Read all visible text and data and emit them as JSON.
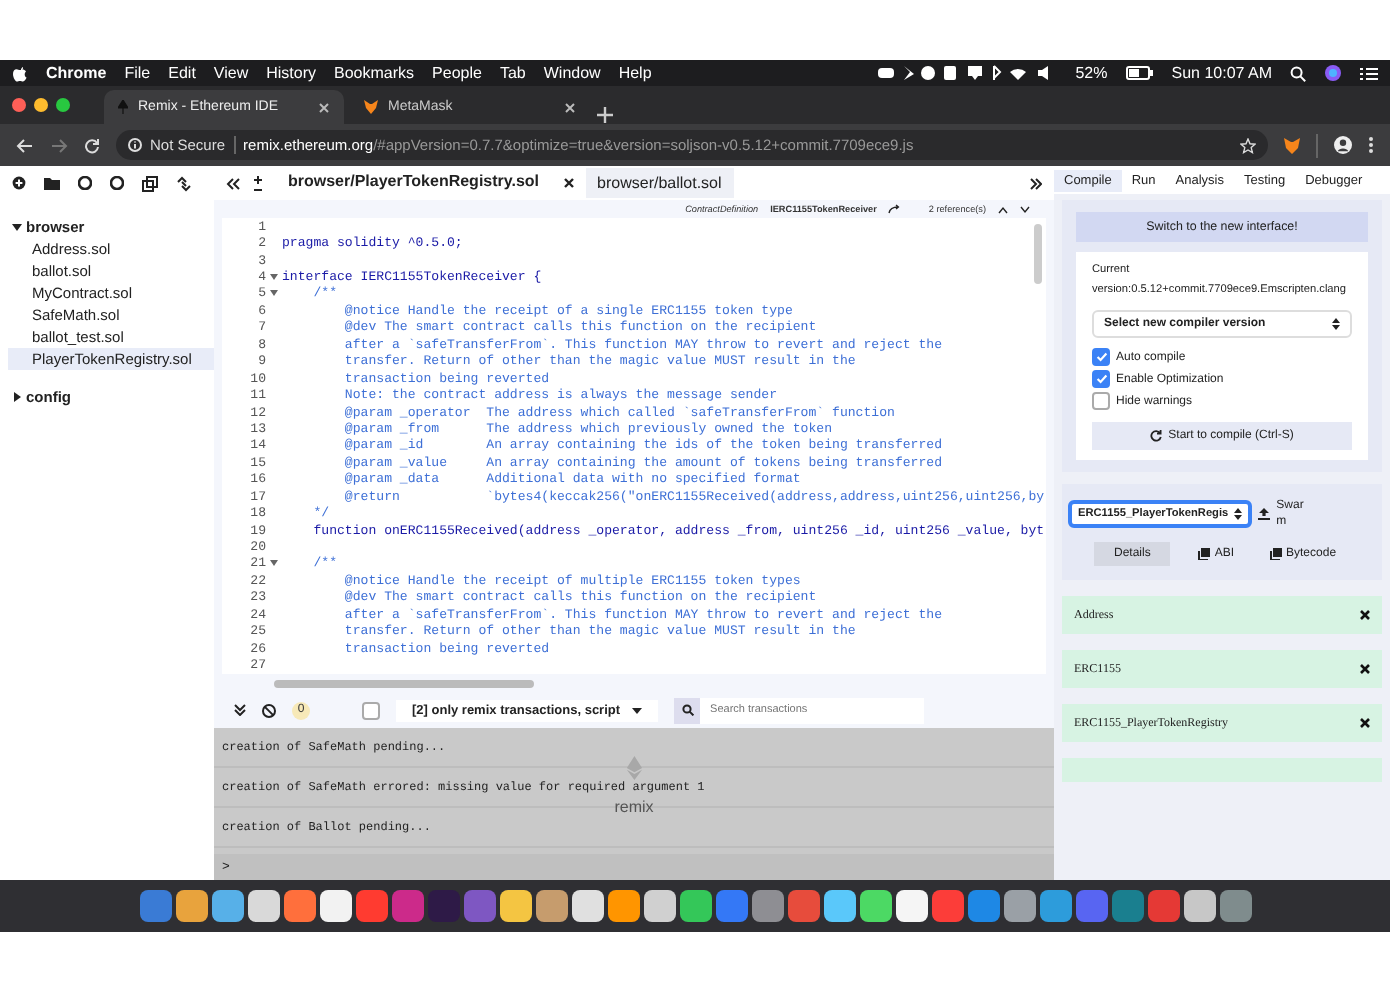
{
  "menu_bar": {
    "app": "Chrome",
    "items": [
      "File",
      "Edit",
      "View",
      "History",
      "Bookmarks",
      "People",
      "Tab",
      "Window",
      "Help"
    ],
    "battery": "52%",
    "clock": "Sun 10:07 AM"
  },
  "browser_tabs": [
    {
      "title": "Remix - Ethereum IDE",
      "selected": true
    },
    {
      "title": "MetaMask",
      "selected": false
    }
  ],
  "address_bar": {
    "security": "Not Secure",
    "host": "remix.ethereum.org",
    "path": "/#appVersion=0.7.7&optimize=true&version=soljson-v0.5.12+commit.7709ece9.js"
  },
  "file_tree": [
    {
      "name": "browser",
      "expanded": true,
      "children": [
        {
          "name": "Address.sol",
          "selected": false
        },
        {
          "name": "ballot.sol",
          "selected": false
        },
        {
          "name": "MyContract.sol",
          "selected": false
        },
        {
          "name": "SafeMath.sol",
          "selected": false
        },
        {
          "name": "ballot_test.sol",
          "selected": false
        },
        {
          "name": "PlayerTokenRegistry.sol",
          "selected": true
        }
      ]
    },
    {
      "name": "config",
      "expanded": false
    }
  ],
  "editor_tabs": [
    {
      "title": "browser/PlayerTokenRegistry.sol",
      "selected": true
    },
    {
      "title": "browser/ballot.sol",
      "selected": false
    }
  ],
  "context": {
    "kind": "ContractDefinition",
    "name": "IERC1155TokenReceiver",
    "references": "2 reference(s)"
  },
  "code_lines": [
    {
      "num": "1",
      "fold": false
    },
    {
      "num": "2",
      "text": "pragma solidity ^0.5.0;",
      "kind": "code",
      "fold": false
    },
    {
      "num": "3",
      "fold": false
    },
    {
      "num": "4",
      "text": "interface IERC1155TokenReceiver {",
      "kind": "code",
      "fold": true
    },
    {
      "num": "5",
      "text": "    /**",
      "kind": "comment",
      "fold": true
    },
    {
      "num": "6",
      "text": "        @notice Handle the receipt of a single ERC1155 token type",
      "kind": "comment",
      "fold": false
    },
    {
      "num": "7",
      "text": "        @dev The smart contract calls this function on the recipient",
      "kind": "comment",
      "fold": false
    },
    {
      "num": "8",
      "text": "        after a `safeTransferFrom`. This function MAY throw to revert and reject the",
      "kind": "comment",
      "fold": false
    },
    {
      "num": "9",
      "text": "        transfer. Return of other than the magic value MUST result in the",
      "kind": "comment",
      "fold": false
    },
    {
      "num": "10",
      "text": "        transaction being reverted",
      "kind": "comment",
      "fold": false
    },
    {
      "num": "11",
      "text": "        Note: the contract address is always the message sender",
      "kind": "comment",
      "fold": false
    },
    {
      "num": "12",
      "text": "        @param _operator  The address which called `safeTransferFrom` function",
      "kind": "comment",
      "fold": false
    },
    {
      "num": "13",
      "text": "        @param _from      The address which previously owned the token",
      "kind": "comment",
      "fold": false
    },
    {
      "num": "14",
      "text": "        @param _id        An array containing the ids of the token being transferred",
      "kind": "comment",
      "fold": false
    },
    {
      "num": "15",
      "text": "        @param _value     An array containing the amount of tokens being transferred",
      "kind": "comment",
      "fold": false
    },
    {
      "num": "16",
      "text": "        @param _data      Additional data with no specified format",
      "kind": "comment",
      "fold": false
    },
    {
      "num": "17",
      "text": "        @return           `bytes4(keccak256(\"onERC1155Received(address,address,uint256,uint256,by",
      "kind": "comment",
      "fold": false
    },
    {
      "num": "18",
      "text": "    */",
      "kind": "comment",
      "fold": false
    },
    {
      "num": "19",
      "text": "    function onERC1155Received(address _operator, address _from, uint256 _id, uint256 _value, byt",
      "kind": "code",
      "fold": false
    },
    {
      "num": "20",
      "fold": false
    },
    {
      "num": "21",
      "text": "    /**",
      "kind": "comment",
      "fold": true
    },
    {
      "num": "22",
      "text": "        @notice Handle the receipt of multiple ERC1155 token types",
      "kind": "comment",
      "fold": false
    },
    {
      "num": "23",
      "text": "        @dev The smart contract calls this function on the recipient",
      "kind": "comment",
      "fold": false
    },
    {
      "num": "24",
      "text": "        after a `safeTransferFrom`. This function MAY throw to revert and reject the",
      "kind": "comment",
      "fold": false
    },
    {
      "num": "25",
      "text": "        transfer. Return of other than the magic value MUST result in the",
      "kind": "comment",
      "fold": false
    },
    {
      "num": "26",
      "text": "        transaction being reverted",
      "kind": "comment",
      "fold": false
    },
    {
      "num": "27",
      "fold": false
    }
  ],
  "terminal": {
    "pending_count": "0",
    "listen_checked": false,
    "filter": "[2] only remix transactions, script",
    "search_placeholder": "Search transactions",
    "logo": "remix",
    "logs": [
      "creation of SafeMath pending...",
      "creation of SafeMath errored: missing value for required argument 1",
      "creation of Ballot pending..."
    ],
    "prompt": ">"
  },
  "right_tabs": [
    {
      "label": "Compile",
      "selected": true
    },
    {
      "label": "Run",
      "selected": false
    },
    {
      "label": "Analysis",
      "selected": false
    },
    {
      "label": "Testing",
      "selected": false
    },
    {
      "label": "Debugger",
      "selected": false
    }
  ],
  "compile": {
    "switch_button": "Switch to the new interface!",
    "current_label": "Current",
    "version": "version:0.5.12+commit.7709ece9.Emscripten.clang",
    "compiler_select": "Select new compiler version",
    "options": [
      {
        "label": "Auto compile",
        "checked": true
      },
      {
        "label": "Enable Optimization",
        "checked": true
      },
      {
        "label": "Hide warnings",
        "checked": false
      }
    ],
    "compile_button": "Start to compile (Ctrl-S)",
    "contract_select": "ERC1155_PlayerTokenRegis",
    "swarm": "Swarm",
    "details": "Details",
    "abi": "ABI",
    "bytecode": "Bytecode"
  },
  "contracts": [
    "Address",
    "ERC1155",
    "ERC1155_PlayerTokenRegistry"
  ]
}
